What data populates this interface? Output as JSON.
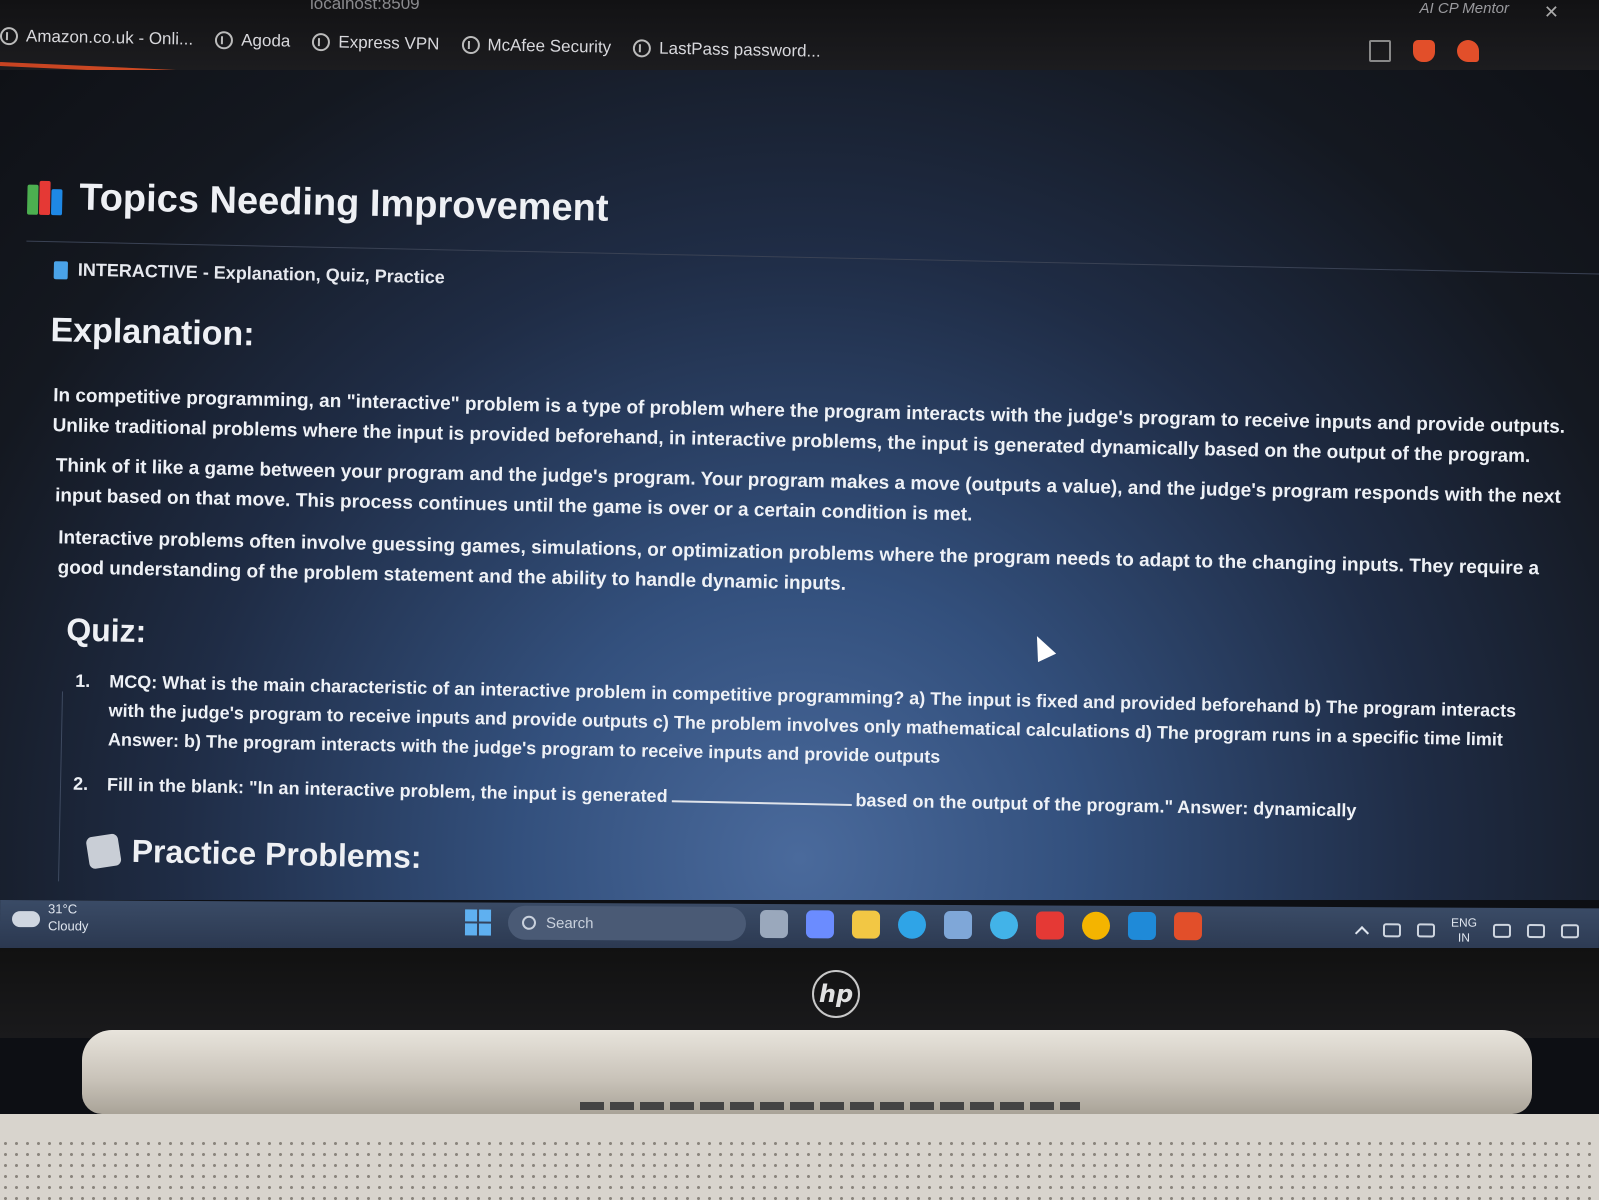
{
  "browser": {
    "tab_title": "localhost:8509",
    "window_title": "AI CP Mentor",
    "bookmarks": [
      "Amazon.co.uk - Onli...",
      "Agoda",
      "Express VPN",
      "McAfee Security",
      "LastPass password..."
    ]
  },
  "page": {
    "title": "Topics Needing Improvement",
    "section_tag": "INTERACTIVE - Explanation, Quiz, Practice",
    "explanation": {
      "heading": "Explanation:",
      "paragraphs": [
        "In competitive programming, an \"interactive\" problem is a type of problem where the program interacts with the judge's program to receive inputs and provide outputs. Unlike traditional problems where the input is provided beforehand, in interactive problems, the input is generated dynamically based on the output of the program.",
        "Think of it like a game between your program and the judge's program. Your program makes a move (outputs a value), and the judge's program responds with the next input based on that move. This process continues until the game is over or a certain condition is met.",
        "Interactive problems often involve guessing games, simulations, or optimization problems where the program needs to adapt to the changing inputs. They require a good understanding of the problem statement and the ability to handle dynamic inputs."
      ]
    },
    "quiz": {
      "heading": "Quiz:",
      "items": [
        {
          "number": "1.",
          "text": "MCQ: What is the main characteristic of an interactive problem in competitive programming? a) The input is fixed and provided beforehand b) The program interacts with the judge's program to receive inputs and provide outputs c) The problem involves only mathematical calculations d) The program runs in a specific time limit Answer: b) The program interacts with the judge's program to receive inputs and provide outputs"
        },
        {
          "number": "2.",
          "text_before": "Fill in the blank: \"In an interactive problem, the input is generated",
          "text_after": "based on the output of the program.\" Answer: dynamically"
        }
      ]
    },
    "practice": {
      "heading": "Practice Problems:"
    }
  },
  "taskbar": {
    "weather_temp": "31°C",
    "weather_desc": "Cloudy",
    "search_placeholder": "Search",
    "lang_top": "ENG",
    "lang_bottom": "IN"
  },
  "device": {
    "logo": "hp"
  },
  "colors": {
    "accent": "#e86a2a",
    "tag_blue": "#4aa3e8",
    "text": "#eef1f6"
  }
}
